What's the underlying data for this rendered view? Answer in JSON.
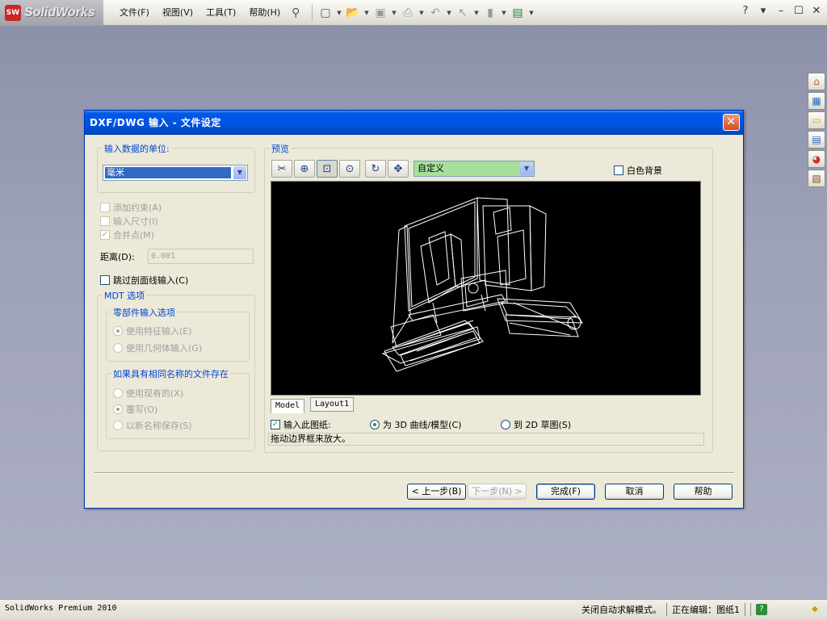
{
  "app": {
    "logo_mark": "SW",
    "logo_text": "SolidWorks",
    "menus": [
      "文件(F)",
      "视图(V)",
      "工具(T)",
      "帮助(H)"
    ],
    "window_controls": [
      "?",
      "▾",
      "–",
      "☐",
      "✕"
    ]
  },
  "dialog": {
    "title": "DXF/DWG 输入 - 文件设定",
    "units": {
      "label": "输入数据的单位:",
      "selected": "毫米"
    },
    "add_constraints": "添加约束(A)",
    "import_dimensions": "输入尺寸(I)",
    "merge_points": "合并点(M)",
    "distance_label": "距离(D):",
    "distance_value": "0.001",
    "skip_hatch": "跳过剖面线输入(C)",
    "mdt": {
      "label": "MDT 选项",
      "part_options": {
        "label": "零部件输入选项",
        "use_features": "使用特征输入(E)",
        "use_geometry": "使用几何体输入(G)"
      },
      "same_name": {
        "label": "如果具有相同名称的文件存在",
        "use_existing": "使用现有的(X)",
        "overwrite": "覆写(O)",
        "save_new": "以新名称保存(S)"
      }
    },
    "preview": {
      "label": "预览",
      "view_select": "自定义",
      "white_bg": "白色背景",
      "tabs": [
        "Model",
        "Layout1"
      ],
      "import_sheet": "输入此图纸:",
      "to_3d": "为 3D 曲线/模型(C)",
      "to_2d": "到 2D 草图(S)",
      "hint": "拖动边界框来放大。"
    },
    "buttons": {
      "back": "< 上一步(B)",
      "next": "下一步(N) >",
      "finish": "完成(F)",
      "cancel": "取消",
      "help": "帮助"
    }
  },
  "statusbar": {
    "product": "SolidWorks Premium 2010",
    "rebuild_mode": "关闭自动求解模式。",
    "editing": "正在编辑：图纸1"
  }
}
